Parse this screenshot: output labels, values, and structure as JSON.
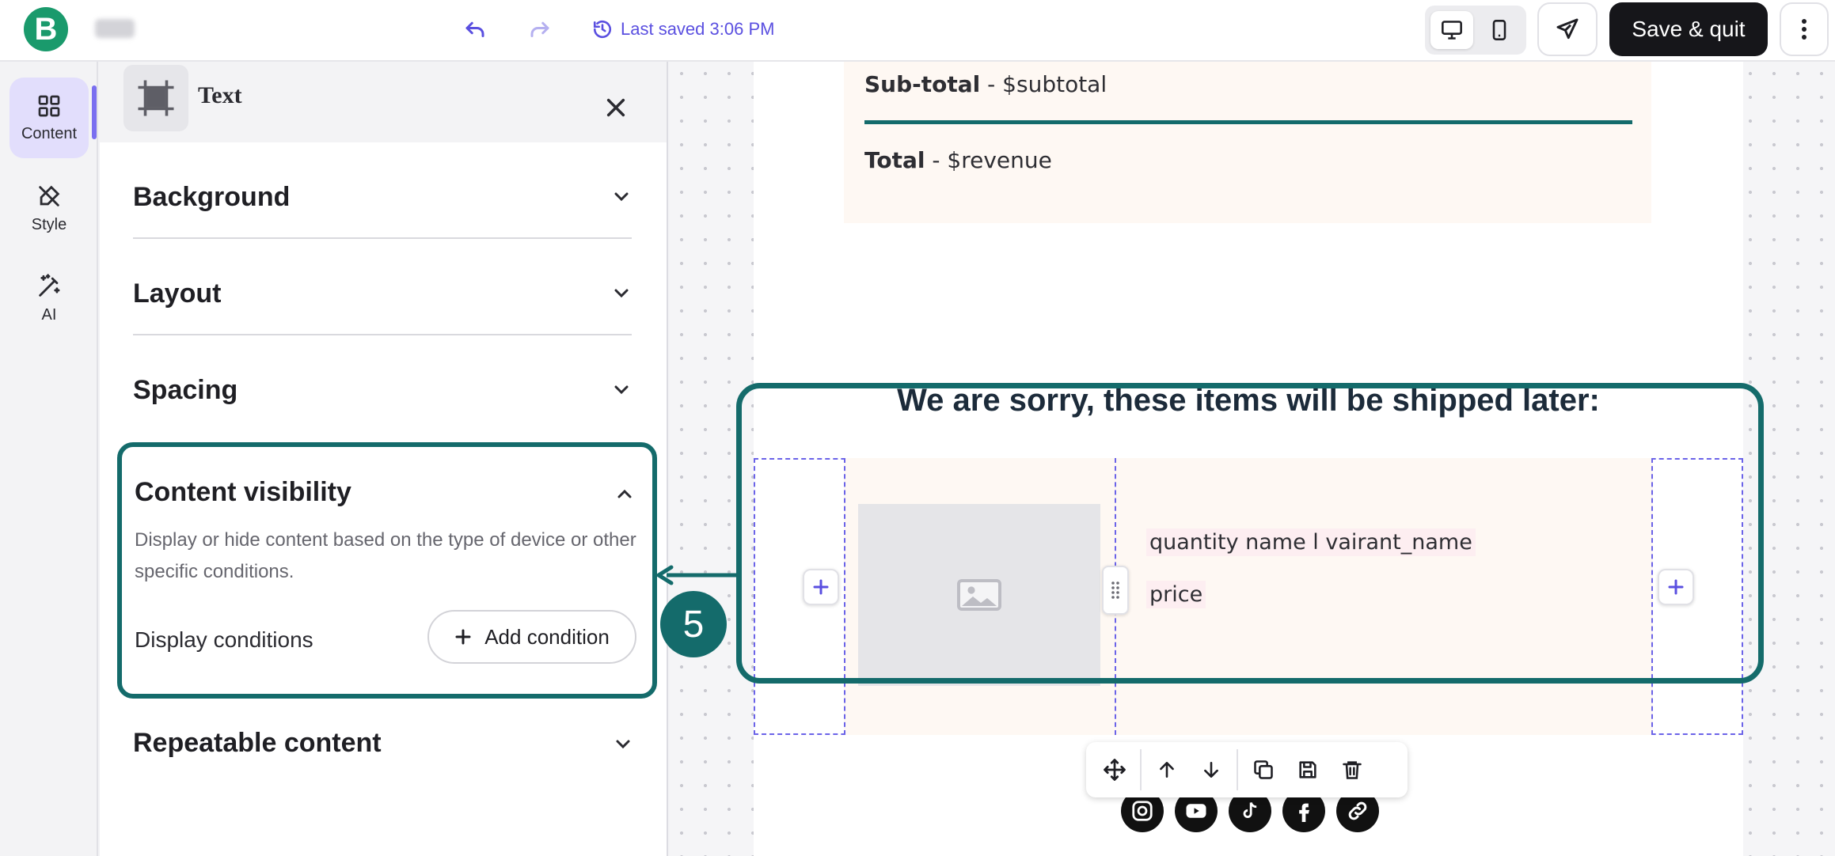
{
  "topbar": {
    "logo_letter": "B",
    "last_saved": "Last saved 3:06 PM",
    "save_quit_label": "Save & quit"
  },
  "rail": {
    "items": [
      {
        "label": "Content",
        "icon": "grid-icon"
      },
      {
        "label": "Style",
        "icon": "brush-icon"
      },
      {
        "label": "AI",
        "icon": "magic-wand-icon"
      }
    ]
  },
  "panel": {
    "title": "Text",
    "sections": [
      {
        "label": "Background"
      },
      {
        "label": "Layout"
      },
      {
        "label": "Spacing"
      }
    ],
    "content_visibility": {
      "title": "Content visibility",
      "description": "Display or hide content based on the type of device or other specific conditions.",
      "display_conditions_label": "Display conditions",
      "add_condition_label": "Add condition"
    },
    "repeatable_content": "Repeatable content"
  },
  "canvas": {
    "subtotal_label": "Sub-total",
    "subtotal_value": " - $subtotal",
    "total_label": "Total",
    "total_value": " - $revenue",
    "heading": "We are sorry, these items will be shipped later:",
    "product_line1": "quantity name l vairant_name",
    "product_line2": "price",
    "step_badge": "5"
  },
  "colors": {
    "accent_teal": "#146b6b",
    "brand_green": "#1a9a6c",
    "primary_purple": "#5a4fe0"
  }
}
